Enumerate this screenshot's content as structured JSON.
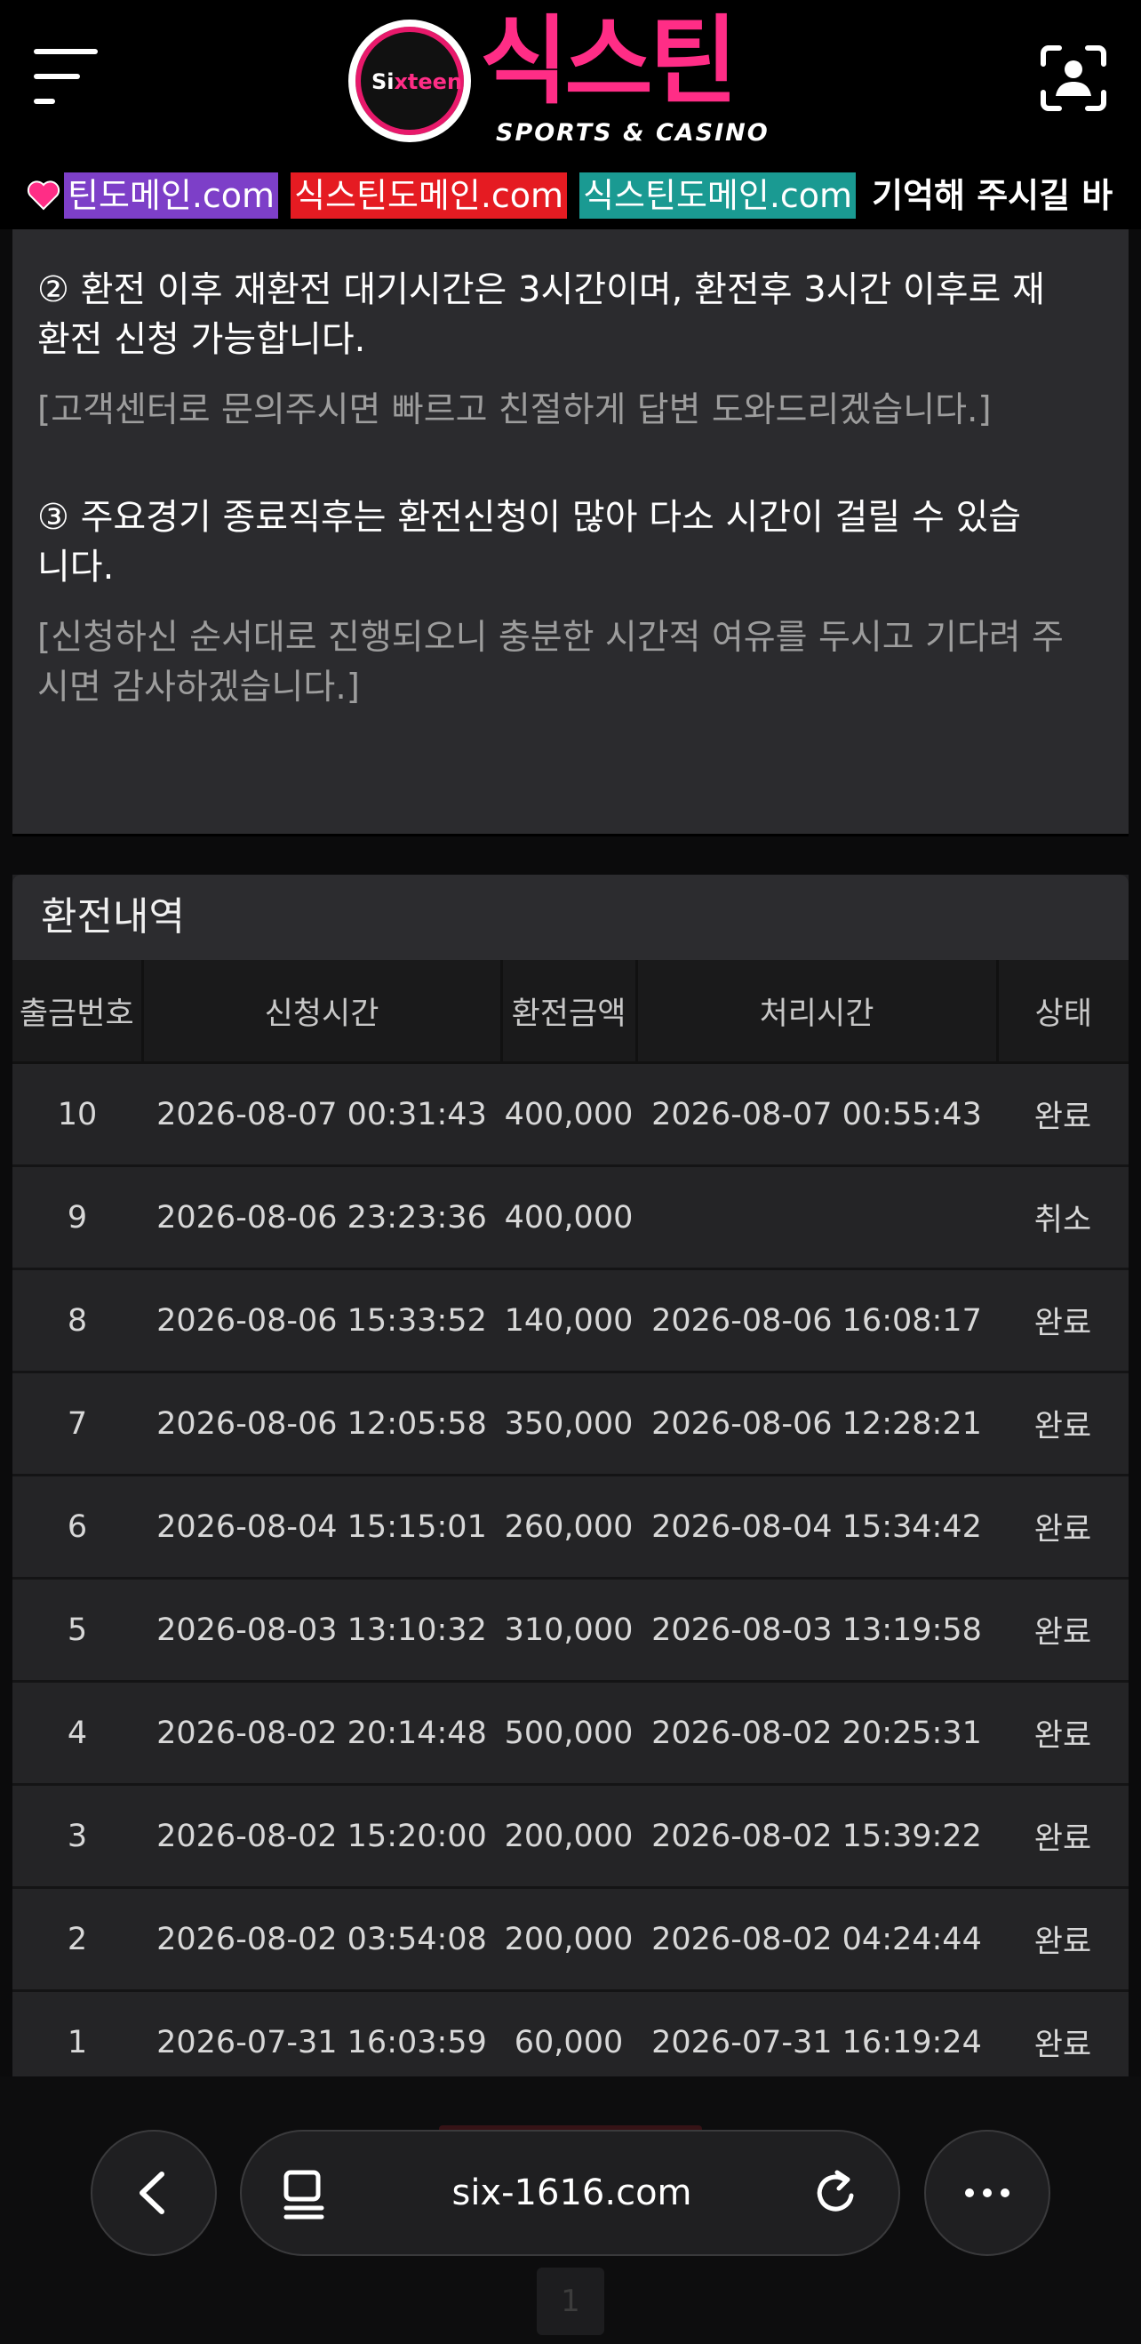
{
  "header": {
    "logo_circle_text_a": "Si",
    "logo_circle_text_b": "xteen",
    "logo_korean": "식스틴",
    "logo_english": "SPORTS & CASINO",
    "menu_icon": "hamburger-menu-icon",
    "profile_icon": "person-scan-icon"
  },
  "marquee": [
    {
      "text": "틴도메인.com",
      "color": "#7d3fc8"
    },
    {
      "text": "식스틴도메인.com",
      "color": "#e51b22"
    },
    {
      "text": "식스틴도메인.com",
      "color": "#1a9a92"
    },
    {
      "text": "기억해 주시길 바",
      "color": ""
    }
  ],
  "notice": {
    "item2_title_line1": "② 환전 이후 재환전 대기시간은 3시간이며, 환전후 3시간 이후로 재",
    "item2_title_line2": "환전 신청 가능합니다.",
    "item2_sub": "[고객센터로 문의주시면 빠르고 친절하게 답변 도와드리겠습니다.]",
    "item3_title_line1": "③ 주요경기 종료직후는 환전신청이 많아 다소 시간이 걸릴 수 있습",
    "item3_title_line2": "니다.",
    "item3_sub_line1": "[신청하신 순서대로 진행되오니 충분한 시간적 여유를 두시고 기다려 주",
    "item3_sub_line2": "시면 감사하겠습니다.]"
  },
  "history": {
    "title": "환전내역",
    "columns": [
      "출금번호",
      "신청시간",
      "환전금액",
      "처리시간",
      "상태"
    ],
    "rows": [
      [
        "10",
        "2026-08-07 00:31:43",
        "400,000",
        "2026-08-07 00:55:43",
        "완료"
      ],
      [
        "9",
        "2026-08-06 23:23:36",
        "400,000",
        "",
        "취소"
      ],
      [
        "8",
        "2026-08-06 15:33:52",
        "140,000",
        "2026-08-06 16:08:17",
        "완료"
      ],
      [
        "7",
        "2026-08-06 12:05:58",
        "350,000",
        "2026-08-06 12:28:21",
        "완료"
      ],
      [
        "6",
        "2026-08-04 15:15:01",
        "260,000",
        "2026-08-04 15:34:42",
        "완료"
      ],
      [
        "5",
        "2026-08-03 13:10:32",
        "310,000",
        "2026-08-03 13:19:58",
        "완료"
      ],
      [
        "4",
        "2026-08-02 20:14:48",
        "500,000",
        "2026-08-02 20:25:31",
        "완료"
      ],
      [
        "3",
        "2026-08-02 15:20:00",
        "200,000",
        "2026-08-02 15:39:22",
        "완료"
      ],
      [
        "2",
        "2026-08-02 03:54:08",
        "200,000",
        "2026-08-02 04:24:44",
        "완료"
      ],
      [
        "1",
        "2026-07-31 16:03:59",
        "60,000",
        "2026-07-31 16:19:24",
        "완료"
      ]
    ]
  },
  "pagination": {
    "current": "1"
  },
  "browser": {
    "url": "six-1616.com",
    "back_icon": "chevron-left-icon",
    "tabs_icon": "tab-overview-icon",
    "reload_icon": "reload-icon",
    "more_icon": "more-dots-icon"
  }
}
